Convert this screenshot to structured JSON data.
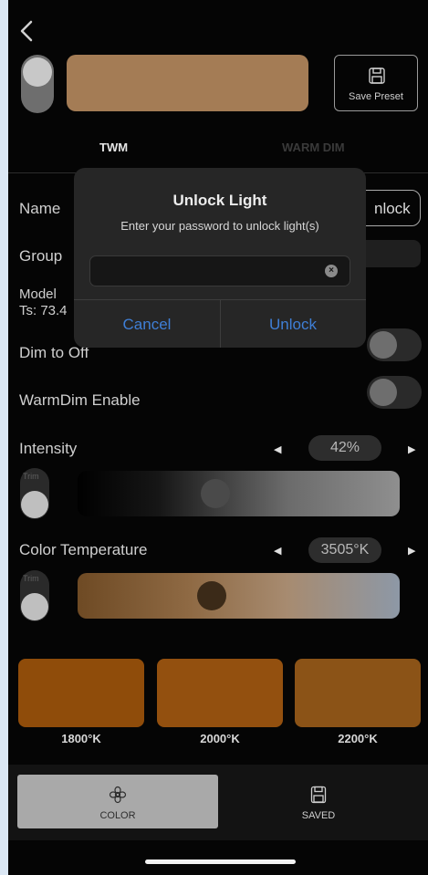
{
  "header": {
    "save_preset_label": "Save Preset"
  },
  "tabs": [
    {
      "label": "TWM"
    },
    {
      "label": "WARM DIM"
    }
  ],
  "settings": {
    "name_label": "Name",
    "unlock_button_label": "nlock",
    "group_label": "Group",
    "model_label": "Model",
    "ts_label": "Ts: 73.4",
    "dim_to_off_label": "Dim to Off",
    "warmdim_label": "WarmDim Enable"
  },
  "intensity": {
    "label": "Intensity",
    "value_text": "42%",
    "value": 42,
    "trim_label": "Trim"
  },
  "color_temperature": {
    "label": "Color Temperature",
    "value_text": "3505°K",
    "value": 3505,
    "trim_label": "Trim"
  },
  "presets": [
    {
      "label": "1800°K",
      "color": "#8f4c0a"
    },
    {
      "label": "2000°K",
      "color": "#93500f"
    },
    {
      "label": "2200°K",
      "color": "#8b5317"
    }
  ],
  "nav": {
    "color_label": "COLOR",
    "saved_label": "SAVED"
  },
  "dialog": {
    "title": "Unlock Light",
    "message": "Enter your password to unlock light(s)",
    "password_value": "",
    "cancel_label": "Cancel",
    "unlock_label": "Unlock"
  },
  "colors": {
    "accent": "#3f7fd6",
    "preview": "#a47c55"
  }
}
